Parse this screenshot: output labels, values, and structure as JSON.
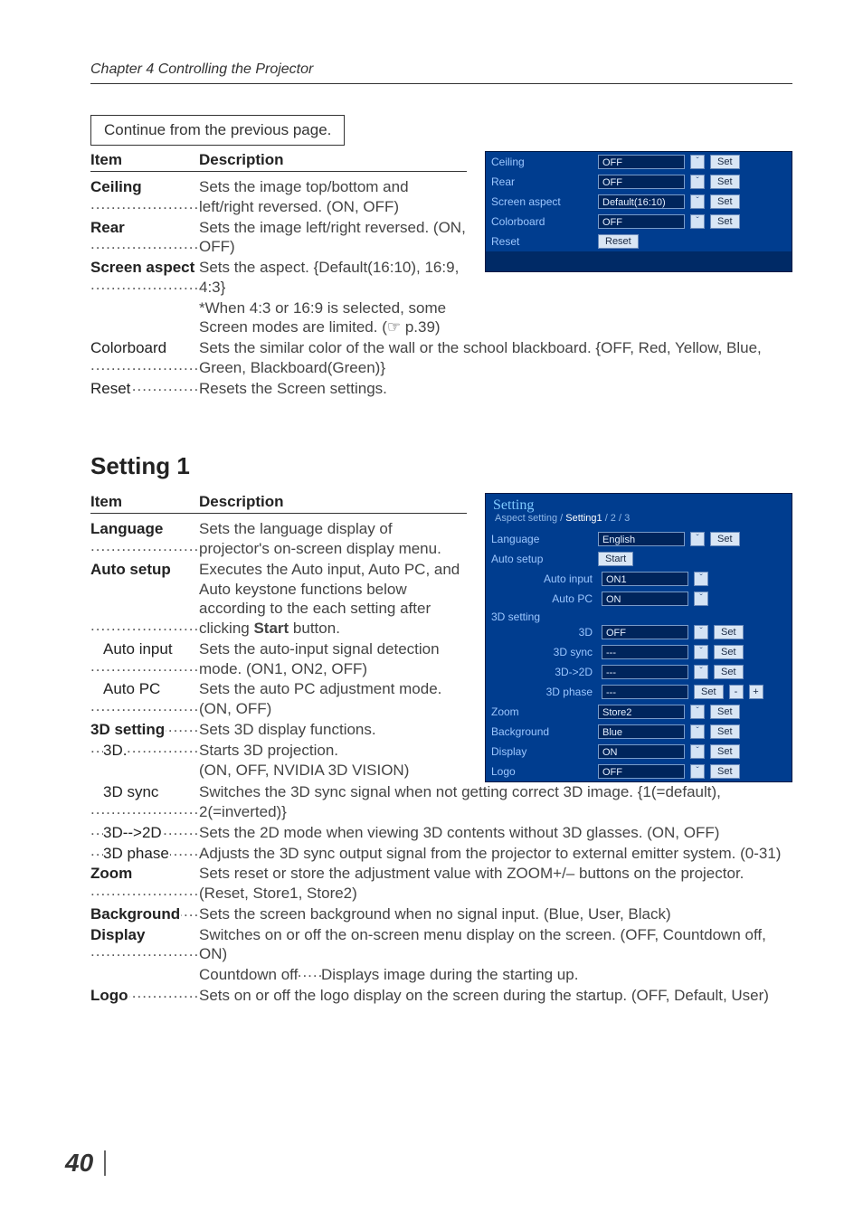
{
  "chapter": "Chapter 4 Controlling the Projector",
  "continueNote": "Continue from the previous page.",
  "headers": {
    "item": "Item",
    "description": "Description"
  },
  "section1": {
    "rows": [
      {
        "label": "Ceiling",
        "bold": true,
        "desc": "Sets the image top/bottom and left/right reversed. (ON, OFF)"
      },
      {
        "label": "Rear",
        "bold": true,
        "desc": "Sets the image left/right reversed. (ON, OFF)"
      },
      {
        "label": "Screen aspect",
        "bold": true,
        "desc": "Sets the aspect. {Default(16:10), 16:9, 4:3}"
      },
      {
        "label": "",
        "bold": false,
        "desc": "*When 4:3 or 16:9 is selected, some Screen modes are limited. (☞ p.39)"
      }
    ],
    "wide": [
      {
        "label": "Colorboard",
        "desc": "Sets the similar color of the wall or the school blackboard. {OFF, Red, Yellow, Blue, Green, Blackboard(Green)}"
      },
      {
        "label": "Reset",
        "desc": "Resets the Screen settings."
      }
    ]
  },
  "panel1": {
    "rows": [
      {
        "label": "Ceiling",
        "value": "OFF",
        "drop": true,
        "set": true
      },
      {
        "label": "Rear",
        "value": "OFF",
        "drop": true,
        "set": true
      },
      {
        "label": "Screen aspect",
        "value": "Default(16:10)",
        "drop": true,
        "set": true
      },
      {
        "label": "Colorboard",
        "value": "OFF",
        "drop": true,
        "set": true
      },
      {
        "label": "Reset",
        "button": "Reset"
      }
    ]
  },
  "section2": {
    "title": "Setting 1",
    "rows": [
      {
        "label": "Language",
        "bold": true,
        "desc": "Sets the language display of projector's on-screen display menu."
      },
      {
        "label": "Auto setup",
        "bold": true,
        "desc": "Executes the Auto input, Auto PC, and Auto keystone functions below according to the each setting after clicking <b>Start</b> button."
      },
      {
        "label": "Auto input",
        "sub": true,
        "desc": "Sets the auto-input signal detection mode. (ON1, ON2, OFF)"
      },
      {
        "label": "Auto PC",
        "sub": true,
        "desc": "Sets the auto PC adjustment mode. (ON, OFF)"
      },
      {
        "label": "3D setting",
        "bold": true,
        "desc": "Sets 3D display functions."
      },
      {
        "label": "3D.",
        "sub": true,
        "desc": "Starts 3D projection."
      },
      {
        "label": "",
        "desc": "(ON, OFF, NVIDIA 3D VISION)"
      }
    ],
    "wide": [
      {
        "label": "3D sync",
        "sub": true,
        "desc": "Switches the 3D sync signal when not getting correct 3D image. {1(=default), 2(=inverted)}"
      },
      {
        "label": "3D-->2D",
        "sub": true,
        "desc": "Sets the 2D mode when viewing 3D contents without 3D glasses. (ON, OFF)"
      },
      {
        "label": "3D phase",
        "sub": true,
        "desc": "Adjusts the 3D sync output signal from the projector to external emitter system. (0-31)"
      },
      {
        "label": "Zoom",
        "bold": true,
        "desc": "Sets reset or store the adjustment value with ZOOM+/– buttons on the projector. (Reset, Store1, Store2)"
      },
      {
        "label": "Background",
        "bold": true,
        "desc": "Sets the screen background  when no signal input. (Blue, User, Black)"
      },
      {
        "label": "Display",
        "bold": true,
        "desc": "Switches on or off the on-screen menu display on the screen. (OFF, Countdown off, ON)"
      },
      {
        "label": "",
        "sub2": true,
        "subLabel": "Countdown off",
        "desc": "Displays image during the starting up."
      },
      {
        "label": "Logo",
        "bold": true,
        "desc": "Sets on or off the logo display on the screen during the startup. (OFF, Default, User)"
      }
    ]
  },
  "panel2": {
    "title": "Setting",
    "crumb": {
      "pre": "Aspect setting / ",
      "active": "Setting1",
      "post": " / 2 / 3"
    },
    "rows": [
      {
        "label": "Language",
        "value": "English",
        "drop": true,
        "set": true
      },
      {
        "label": "Auto setup",
        "button": "Start"
      }
    ],
    "autoSub": [
      {
        "label": "Auto input",
        "value": "ON1",
        "drop": true
      },
      {
        "label": "Auto PC",
        "value": "ON",
        "drop": true
      }
    ],
    "sec3d": "3D setting",
    "sub3d": [
      {
        "label": "3D",
        "value": "OFF",
        "drop": true,
        "set": true
      },
      {
        "label": "3D sync",
        "value": "---",
        "drop": true,
        "set": true
      },
      {
        "label": "3D->2D",
        "value": "---",
        "drop": true,
        "set": true
      },
      {
        "label": "3D phase",
        "value": "---",
        "set": true,
        "pm": true
      }
    ],
    "rows2": [
      {
        "label": "Zoom",
        "value": "Store2",
        "drop": true,
        "set": true
      },
      {
        "label": "Background",
        "value": "Blue",
        "drop": true,
        "set": true
      },
      {
        "label": "Display",
        "value": "ON",
        "drop": true,
        "set": true
      },
      {
        "label": "Logo",
        "value": "OFF",
        "drop": true,
        "set": true
      }
    ]
  },
  "pageNumber": "40",
  "ui": {
    "set": "Set",
    "minus": "-",
    "plus": "+",
    "chev": "ˇ"
  }
}
